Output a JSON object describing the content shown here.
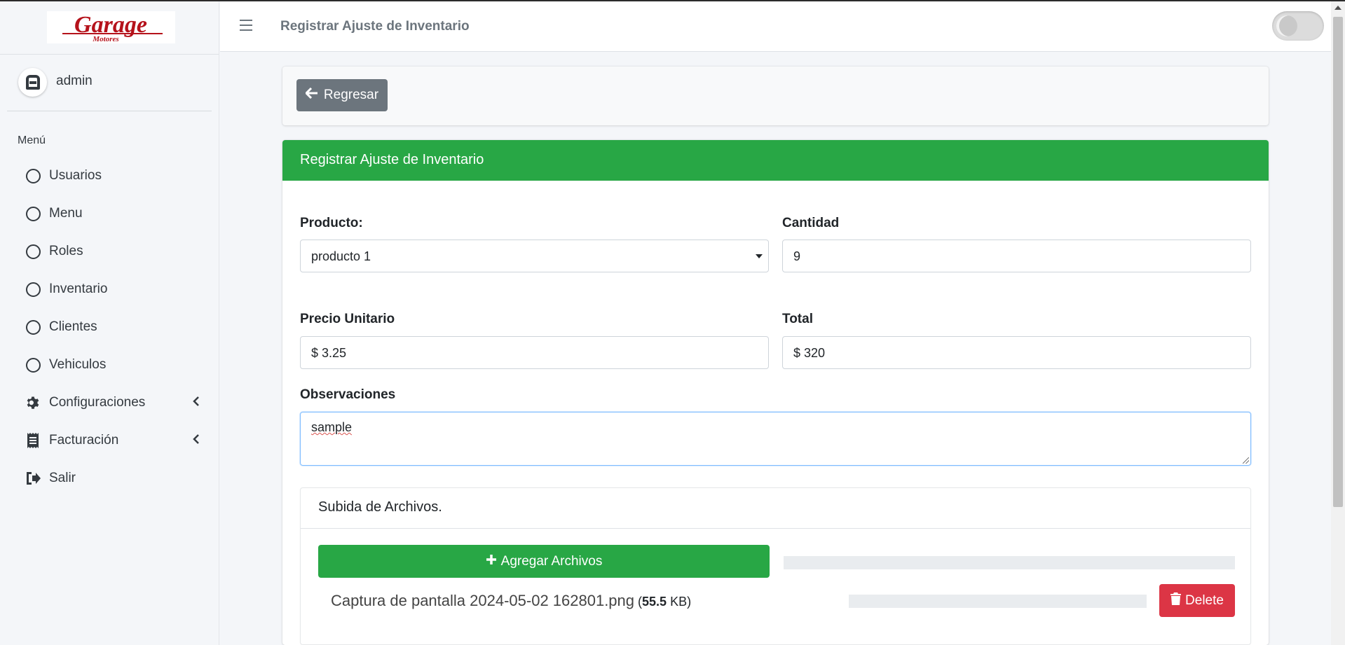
{
  "brand": {
    "logo_text": "Garage",
    "logo_subtext": "Motores"
  },
  "user": {
    "name": "admin"
  },
  "sidebar": {
    "header": "Menú",
    "items": [
      {
        "label": "Usuarios",
        "icon": "circle-icon"
      },
      {
        "label": "Menu",
        "icon": "circle-icon"
      },
      {
        "label": "Roles",
        "icon": "circle-icon"
      },
      {
        "label": "Inventario",
        "icon": "circle-icon"
      },
      {
        "label": "Clientes",
        "icon": "circle-icon"
      },
      {
        "label": "Vehiculos",
        "icon": "circle-icon"
      },
      {
        "label": "Configuraciones",
        "icon": "gear-icon",
        "has_submenu": true
      },
      {
        "label": "Facturación",
        "icon": "receipt-icon",
        "has_submenu": true
      },
      {
        "label": "Salir",
        "icon": "sign-out-icon"
      }
    ]
  },
  "header": {
    "title": "Registrar Ajuste de Inventario"
  },
  "toolbar": {
    "back_label": "Regresar"
  },
  "form": {
    "title": "Registrar Ajuste de Inventario",
    "producto_label": "Producto:",
    "producto_value": "producto 1",
    "cantidad_label": "Cantidad",
    "cantidad_value": "9",
    "precio_label": "Precio Unitario",
    "precio_value": "$ 3.25",
    "total_label": "Total",
    "total_value": "$ 320",
    "observaciones_label": "Observaciones",
    "observaciones_value": "sample"
  },
  "upload": {
    "title": "Subida de Archivos.",
    "add_label": "Agregar Archivos",
    "file_name": "Captura de pantalla 2024-05-02 162801.png",
    "file_size": "55.5",
    "file_size_unit": "KB",
    "delete_label": "Delete"
  },
  "colors": {
    "success": "#28a745",
    "danger": "#dc3545",
    "secondary": "#6c757d",
    "brand_red": "#b5121b"
  }
}
